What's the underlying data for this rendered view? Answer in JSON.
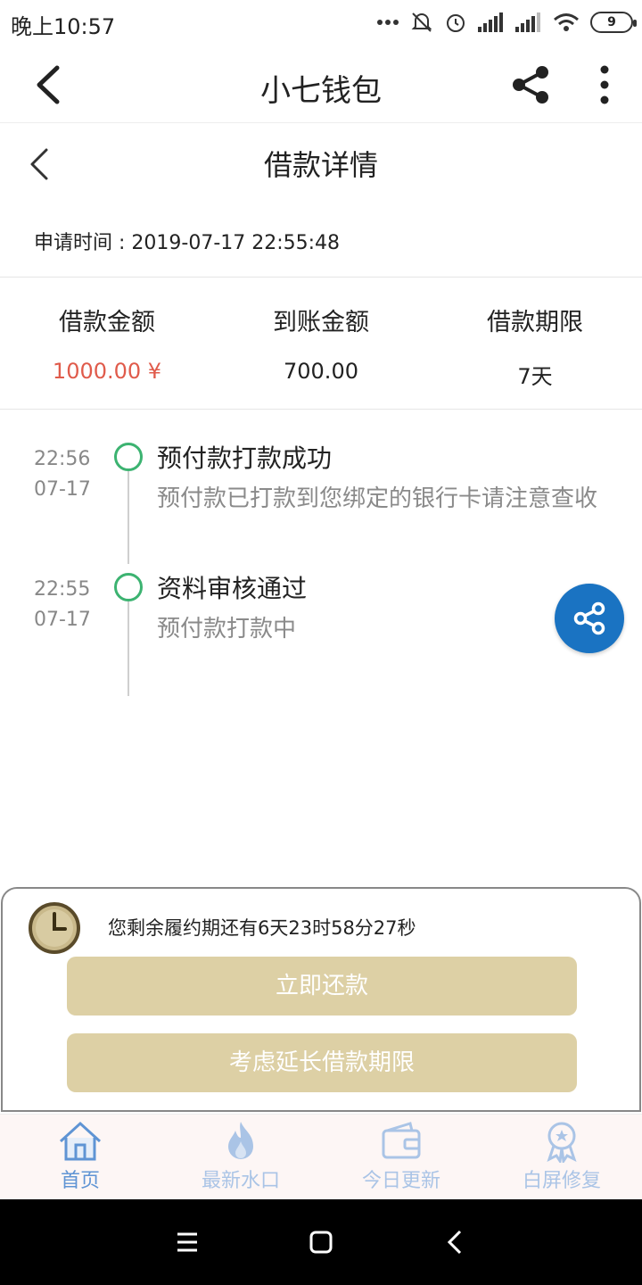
{
  "status_bar": {
    "time": "晚上10:57",
    "battery": "9"
  },
  "app_bar": {
    "title": "小七钱包"
  },
  "detail": {
    "title": "借款详情",
    "apply_time": "申请时间 : 2019-07-17 22:55:48"
  },
  "stats": [
    {
      "label": "借款金额",
      "value": "1000.00 ¥",
      "color": "#e05b4b"
    },
    {
      "label": "到账金额",
      "value": "700.00"
    },
    {
      "label": "借款期限",
      "value": "7天"
    }
  ],
  "timeline": [
    {
      "time": "22:56",
      "date": "07-17",
      "title": "预付款打款成功",
      "desc": "预付款已打款到您绑定的银行卡请注意查收"
    },
    {
      "time": "22:55",
      "date": "07-17",
      "title": "资料审核通过",
      "desc": "预付款打款中"
    }
  ],
  "repay_panel": {
    "countdown": "您剩余履约期还有6天23时58分27秒",
    "repay_button": "立即还款",
    "extend_button": "考虑延长借款期限"
  },
  "tabbar": {
    "items": [
      {
        "label": "首页",
        "icon": "home-icon",
        "active": true
      },
      {
        "label": "最新水口",
        "icon": "flame-icon",
        "active": false
      },
      {
        "label": "今日更新",
        "icon": "wallet-icon",
        "active": false
      },
      {
        "label": "白屏修复",
        "icon": "award-icon",
        "active": false
      }
    ]
  },
  "colors": {
    "accent": "#1a73c2",
    "button": "#ddd0a5",
    "success": "#3cb371",
    "amount": "#e05b4b",
    "tab_active": "#5f94d4",
    "tab_inactive": "#aac4e6"
  }
}
